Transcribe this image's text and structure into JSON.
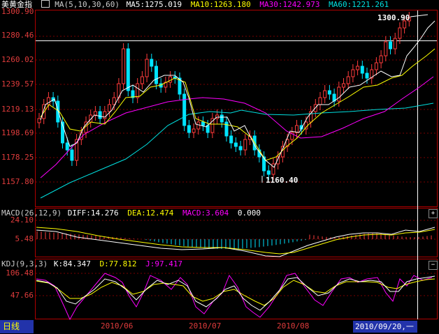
{
  "main_panel": {
    "instrument": "美黄金指",
    "ma_group": "MA(5,10,30,60)",
    "ma5": "MA5:1275.019",
    "ma10": "MA10:1263.180",
    "ma30": "MA30:1242.973",
    "ma60": "MA60:1221.261",
    "y_ticks": [
      "1300.90",
      "1280.46",
      "1260.02",
      "1239.57",
      "1219.13",
      "1198.69",
      "1178.25",
      "1157.80"
    ],
    "high_label": "1300.90",
    "low_label": "1160.40"
  },
  "macd_panel": {
    "title": "MACD(26,12,9)",
    "diff": "DIFF:14.276",
    "dea": "DEA:12.474",
    "macd": "MACD:3.604",
    "zero": "0.000",
    "y_ticks": [
      "24.10",
      "5.48"
    ]
  },
  "kdj_panel": {
    "title": "KDJ(9,3,3)",
    "k": "K:84.347",
    "d": "D:77.812",
    "j": "J:97.417",
    "y_ticks": [
      "106.48",
      "47.66"
    ]
  },
  "bottom_bar": {
    "period": "日线",
    "dates": [
      "2010/06",
      "2010/07",
      "2010/08"
    ],
    "cursor_date": "2010/09/20,一"
  },
  "colors": {
    "up": "#ff3c3c",
    "down": "#00e4ff",
    "ma5": "#ffffff",
    "ma10": "#ffff00",
    "ma30": "#ff00ff",
    "ma60": "#00e0e0",
    "grid": "#8b0000",
    "axis_text": "#e03c3c"
  },
  "icons": {
    "ma_toggle": "ma-toggle-icon",
    "expand": "plus-icon",
    "collapse": "minus-icon"
  },
  "chart_data": {
    "type": "candlestick",
    "ylim": [
      1150,
      1310
    ],
    "series": [
      {
        "name": "MA5"
      },
      {
        "name": "MA10"
      },
      {
        "name": "MA30"
      },
      {
        "name": "MA60"
      }
    ]
  }
}
